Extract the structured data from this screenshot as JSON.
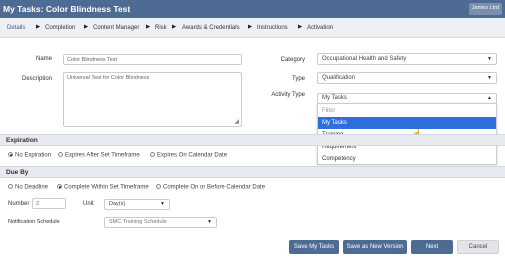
{
  "header": {
    "title": "My Tasks: Color Blindness Test",
    "user": "James Ltrd"
  },
  "tabs": [
    {
      "label": "Details"
    },
    {
      "label": "Completion"
    },
    {
      "label": "Content Manager"
    },
    {
      "label": "Risk"
    },
    {
      "label": "Awards & Credentials"
    },
    {
      "label": "Instructions"
    },
    {
      "label": "Activation"
    }
  ],
  "form": {
    "name_label": "Name",
    "name_value": "Color Blindness Test",
    "description_label": "Description",
    "description_value": "Universal Test for Color Blindness",
    "category_label": "Category",
    "category_value": "Occupational Health and Safety",
    "type_label": "Type",
    "type_value": "Qualification",
    "activity_type_label": "Activity Type",
    "activity_type_value": "My Tasks"
  },
  "activity_dropdown": {
    "filter_placeholder": "Filter",
    "options": [
      "My Tasks",
      "Training",
      "Requirement",
      "Competency"
    ],
    "selected_index": 0
  },
  "expiration": {
    "heading": "Expiration",
    "options": [
      "No Expiration",
      "Expires After Set Timeframe",
      "Expires On Calendar Date"
    ],
    "selected_index": 0
  },
  "due_by": {
    "heading": "Due By",
    "options": [
      "No Deadline",
      "Complete Within Set Timeframe",
      "Complete On or Before Calendar Date"
    ],
    "selected_index": 1,
    "number_label": "Number",
    "number_value": "2",
    "unit_label": "Unit",
    "unit_value": "Day(s)",
    "schedule_label": "Notification Schedule",
    "schedule_value": "SMC Training Schedule"
  },
  "buttons": {
    "save_my_tasks": "Save My Tasks",
    "save_new_version": "Save as New Version",
    "next": "Next",
    "cancel": "Cancel"
  },
  "colors": {
    "header": "#4d6b93",
    "selected": "#2f6fd8"
  }
}
